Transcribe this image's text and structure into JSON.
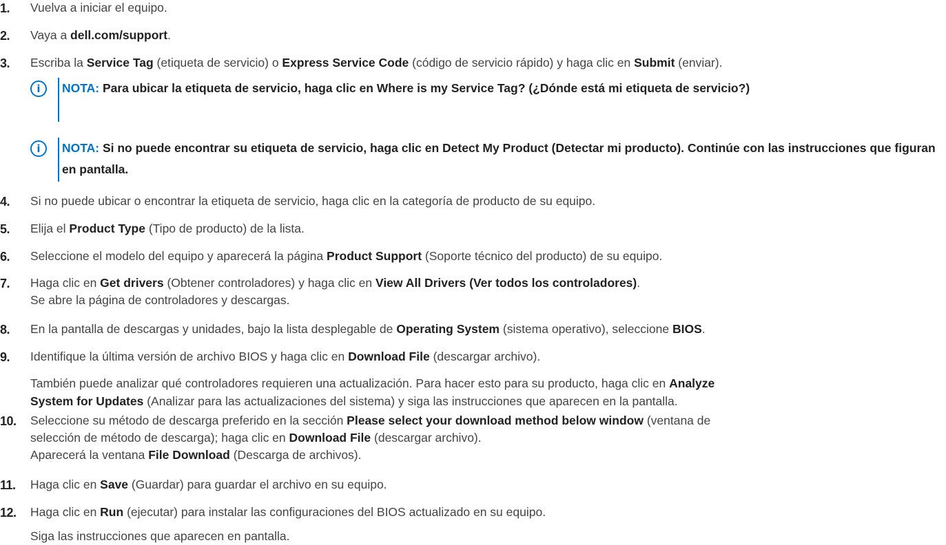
{
  "steps": [
    {
      "num": "1.",
      "parts": [
        {
          "t": "Vuelva a iniciar el equipo.",
          "b": false
        }
      ]
    },
    {
      "num": "2.",
      "parts": [
        {
          "t": "Vaya a ",
          "b": false
        },
        {
          "t": "dell.com/support",
          "b": true
        },
        {
          "t": ".",
          "b": false
        }
      ]
    },
    {
      "num": "3.",
      "parts": [
        {
          "t": "Escriba la ",
          "b": false
        },
        {
          "t": "Service Tag",
          "b": true
        },
        {
          "t": " (etiqueta de servicio) o ",
          "b": false
        },
        {
          "t": "Express Service Code",
          "b": true
        },
        {
          "t": " (código de servicio rápido) y haga clic en ",
          "b": false
        },
        {
          "t": "Submit",
          "b": true
        },
        {
          "t": " (enviar).",
          "b": false
        }
      ]
    },
    {
      "num": "4.",
      "parts": [
        {
          "t": "Si no puede ubicar o encontrar la etiqueta de servicio, haga clic en la categoría de producto de su equipo.",
          "b": false
        }
      ]
    },
    {
      "num": "5.",
      "parts": [
        {
          "t": "Elija el ",
          "b": false
        },
        {
          "t": "Product Type",
          "b": true
        },
        {
          "t": " (Tipo de producto) de la lista.",
          "b": false
        }
      ]
    },
    {
      "num": "6.",
      "parts": [
        {
          "t": "Seleccione el modelo del equipo y aparecerá la página ",
          "b": false
        },
        {
          "t": "Product Support",
          "b": true
        },
        {
          "t": " (Soporte técnico del producto) de su equipo.",
          "b": false
        }
      ]
    },
    {
      "num": "7.",
      "parts": [
        {
          "t": "Haga clic en ",
          "b": false
        },
        {
          "t": "Get drivers",
          "b": true
        },
        {
          "t": " (Obtener controladores) y haga clic en ",
          "b": false
        },
        {
          "t": "View All Drivers (Ver todos los controladores)",
          "b": true
        },
        {
          "t": ".",
          "b": false
        }
      ]
    },
    {
      "num": "8.",
      "parts": [
        {
          "t": "En la pantalla de descargas y unidades, bajo la lista desplegable de ",
          "b": false
        },
        {
          "t": "Operating System",
          "b": true
        },
        {
          "t": " (sistema operativo), seleccione ",
          "b": false
        },
        {
          "t": "BIOS",
          "b": true
        },
        {
          "t": ".",
          "b": false
        }
      ]
    },
    {
      "num": "9.",
      "parts": [
        {
          "t": "Identifique la última versión de archivo BIOS y haga clic en ",
          "b": false
        },
        {
          "t": "Download File",
          "b": true
        },
        {
          "t": " (descargar archivo).",
          "b": false
        }
      ]
    },
    {
      "num": "10.",
      "parts": [
        {
          "t": "Seleccione su método de descarga preferido en la sección ",
          "b": false
        },
        {
          "t": "Please select your download method below window",
          "b": true
        },
        {
          "t": " (ventana de",
          "b": false
        }
      ]
    },
    {
      "num": "11.",
      "parts": [
        {
          "t": "Haga clic en ",
          "b": false
        },
        {
          "t": "Save",
          "b": true
        },
        {
          "t": " (Guardar) para guardar el archivo en su equipo.",
          "b": false
        }
      ]
    },
    {
      "num": "12.",
      "parts": [
        {
          "t": "Haga clic en ",
          "b": false
        },
        {
          "t": "Run",
          "b": true
        },
        {
          "t": " (ejecutar) para instalar las configuraciones del BIOS actualizado en su equipo.",
          "b": false
        }
      ]
    }
  ],
  "extra_lines": [
    {
      "parts": [
        {
          "t": "Se abre la página de controladores y descargas.",
          "b": false
        }
      ]
    },
    {
      "parts": [
        {
          "t": "También puede analizar qué controladores requieren una actualización. Para hacer esto para su producto, haga clic en ",
          "b": false
        },
        {
          "t": "Analyze",
          "b": true
        }
      ]
    },
    {
      "parts": [
        {
          "t": "System for Updates",
          "b": true
        },
        {
          "t": " (Analizar para las actualizaciones del sistema) y siga las instrucciones que aparecen en la pantalla.",
          "b": false
        }
      ]
    },
    {
      "parts": [
        {
          "t": "selección de método de descarga); haga clic en ",
          "b": false
        },
        {
          "t": "Download File",
          "b": true
        },
        {
          "t": " (descargar archivo).",
          "b": false
        }
      ]
    },
    {
      "parts": [
        {
          "t": "Aparecerá la ventana ",
          "b": false
        },
        {
          "t": "File Download",
          "b": true
        },
        {
          "t": " (Descarga de archivos).",
          "b": false
        }
      ]
    },
    {
      "parts": [
        {
          "t": "Siga las instrucciones que aparecen en pantalla.",
          "b": false
        }
      ]
    }
  ],
  "notes": [
    {
      "icon": "i",
      "label": "NOTA:",
      "text": " Para ubicar la etiqueta de servicio, haga clic en Where is my Service Tag? (¿Dónde está mi etiqueta de servicio?)"
    },
    {
      "icon": "i",
      "label": "NOTA:",
      "text": " Si no puede encontrar su etiqueta de servicio, haga clic en Detect My Product (Detectar mi producto). Continúe con las instrucciones que figuran en pantalla."
    }
  ],
  "colors": {
    "note_accent": "#0073c7",
    "text": "#444444",
    "bold_text": "#222222"
  }
}
